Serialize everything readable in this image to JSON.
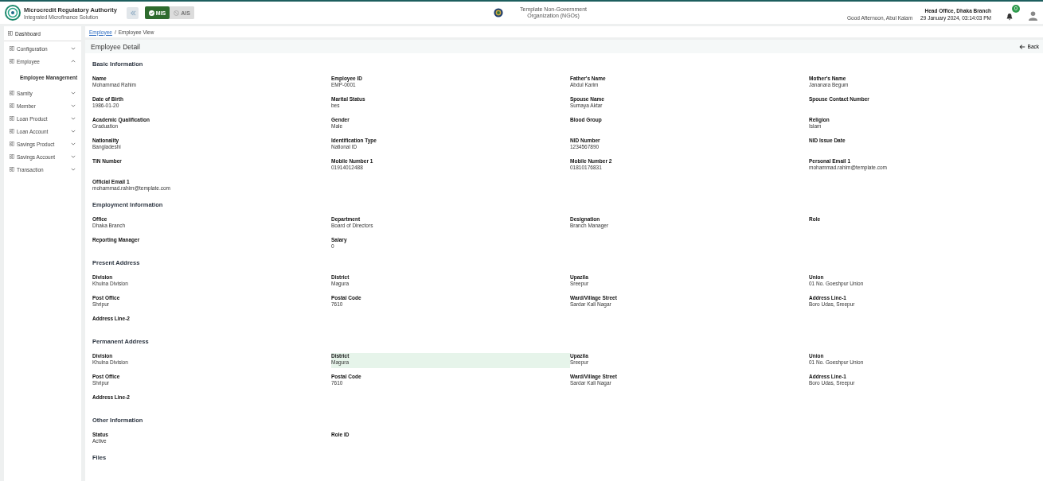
{
  "header": {
    "org_title": "Microcredit Regulatory Authority",
    "org_subtitle": "Integrated Microfinance Solution",
    "modules": [
      {
        "label": "MIS",
        "selected": true
      },
      {
        "label": "AIS",
        "selected": false
      }
    ],
    "ngo_name": "Template Non-Government Organization (NGOs)",
    "greeting": "Good Afternoon, Abul Kalam",
    "office": "Head Office, Dhaka Branch",
    "datetime": "29 January 2024, 03:14:03 PM",
    "notification_count": "0"
  },
  "sidebar": {
    "items": [
      {
        "label": "Dashboard"
      },
      {
        "label": "Configuration",
        "expanded": false
      },
      {
        "label": "Employee",
        "expanded": true,
        "children": [
          {
            "label": "Employee Management"
          }
        ]
      },
      {
        "label": "Samity",
        "expanded": false
      },
      {
        "label": "Member",
        "expanded": false
      },
      {
        "label": "Loan Product",
        "expanded": false
      },
      {
        "label": "Loan Account",
        "expanded": false
      },
      {
        "label": "Savings Product",
        "expanded": false
      },
      {
        "label": "Savings Account",
        "expanded": false
      },
      {
        "label": "Transaction",
        "expanded": false
      }
    ]
  },
  "breadcrumb": {
    "link": "Employee",
    "separator": "/",
    "current": "Employee View"
  },
  "page": {
    "title": "Employee Detail",
    "back": "Back"
  },
  "sections": [
    {
      "title": "Basic Information",
      "fields": [
        {
          "label": "Name",
          "value": "Mohammad Rahim"
        },
        {
          "label": "Employee ID",
          "value": "EMP-0001"
        },
        {
          "label": "Father's Name",
          "value": "Abdul Karim"
        },
        {
          "label": "Mother's Name",
          "value": "Jananara Begum"
        },
        {
          "label": "Date of Birth",
          "value": "1986-01-20"
        },
        {
          "label": "Marital Status",
          "value": "bes"
        },
        {
          "label": "Spouse Name",
          "value": "Sumaya Aktar"
        },
        {
          "label": "Spouse Contact Number"
        },
        {
          "label": "Academic Qualification",
          "value": "Graduation"
        },
        {
          "label": "Gender",
          "value": "Male"
        },
        {
          "label": "Blood Group"
        },
        {
          "label": "Religion",
          "value": "Islam"
        },
        {
          "label": "Nationality",
          "value": "Bangladeshi"
        },
        {
          "label": "Identification Type",
          "value": "National ID"
        },
        {
          "label": "NID Number",
          "value": "1234567890"
        },
        {
          "label": "NID Issue Date"
        },
        {
          "label": "TIN Number"
        },
        {
          "label": "Mobile Number 1",
          "value": "01914012488"
        },
        {
          "label": "Mobile Number 2",
          "value": "01810176831"
        },
        {
          "label": "Personal Email 1",
          "value": "mohammad.rahim@template.com"
        },
        {
          "label": "Official Email 1",
          "value": "mohammad.rahim@template.com"
        }
      ]
    },
    {
      "title": "Employment Information",
      "fields": [
        {
          "label": "Office",
          "value": "Dhaka Branch"
        },
        {
          "label": "Department",
          "value": "Board of Directors"
        },
        {
          "label": "Designation",
          "value": "Branch Manager"
        },
        {
          "label": "Role"
        },
        {
          "label": "Reporting Manager"
        },
        {
          "label": "Salary",
          "value": "0"
        }
      ]
    },
    {
      "title": "Present Address",
      "fields": [
        {
          "label": "Division",
          "value": "Khulna Division"
        },
        {
          "label": "District",
          "value": "Magura"
        },
        {
          "label": "Upazila",
          "value": "Sreepur"
        },
        {
          "label": "Union",
          "value": "01 No. Goeshpur Union"
        },
        {
          "label": "Post Office",
          "value": "Shripur"
        },
        {
          "label": "Postal Code",
          "value": "7610"
        },
        {
          "label": "Ward/Village Street",
          "value": "Sardar Kali Nagar"
        },
        {
          "label": "Address Line-1",
          "value": "Boro Udas, Sreepur"
        },
        {
          "label": "Address Line-2"
        }
      ]
    },
    {
      "title": "Permanent Address",
      "fields": [
        {
          "label": "Division",
          "value": "Khulna Division",
          "highlighted": false
        },
        {
          "label": "District",
          "value": "Magura",
          "highlighted": true
        },
        {
          "label": "Upazila",
          "value": "Sreepur",
          "highlighted": false
        },
        {
          "label": "Union",
          "value": "01 No. Goeshpur Union",
          "highlighted": false
        },
        {
          "label": "Post Office",
          "value": "Shripur",
          "highlighted": false
        },
        {
          "label": "Postal Code",
          "value": "7610",
          "highlighted": false
        },
        {
          "label": "Ward/Village Street",
          "value": "Sardar Kali Nagar",
          "highlighted": false
        },
        {
          "label": "Address Line-1",
          "value": "Boro Udas, Sreepur",
          "highlighted": false
        },
        {
          "label": "Address Line-2",
          "highlighted": false
        }
      ]
    },
    {
      "title": "Other Information",
      "fields": [
        {
          "label": "Status",
          "value": "Active"
        },
        {
          "label": "Role ID"
        }
      ]
    },
    {
      "title": "Files"
    }
  ]
}
